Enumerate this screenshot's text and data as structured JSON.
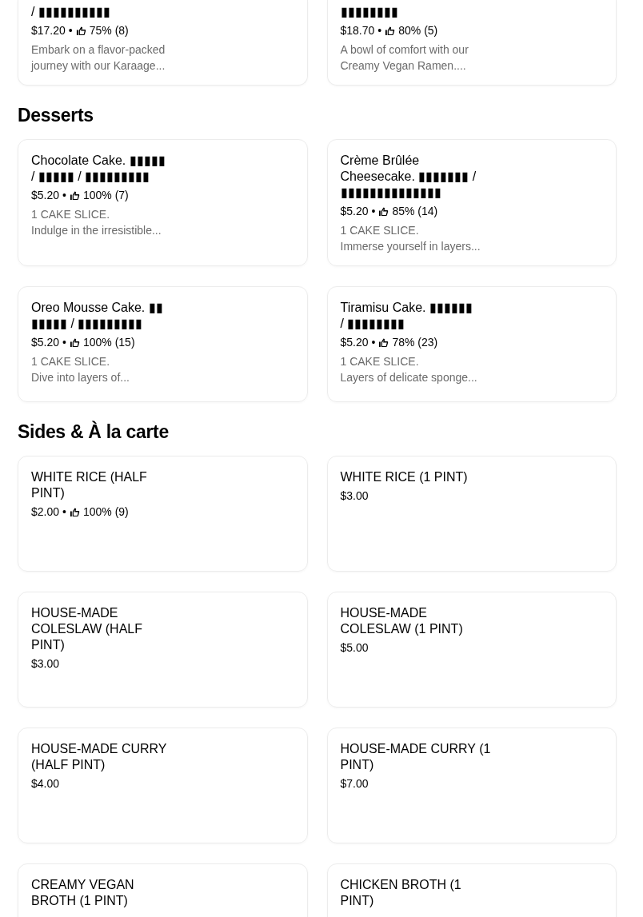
{
  "sections": [
    {
      "cut_top": true,
      "items": [
        {
          "title": "/  ▮▮▮▮▮▮▮▮▮▮",
          "price": "$17.20",
          "sep": "•",
          "rating": "75% (8)",
          "description": "Embark on a flavor-packed\njourney with our Karaage..."
        },
        {
          "title": "▮▮▮▮▮▮▮▮",
          "price": "$18.70",
          "sep": "•",
          "rating": "80% (5)",
          "description": "A bowl of comfort with our\nCreamy Vegan Ramen...."
        }
      ]
    },
    {
      "heading": "Desserts",
      "items": [
        {
          "title": "Chocolate Cake.  ▮▮▮▮▮\n/  ▮▮▮▮▮   /  ▮▮▮▮▮▮▮▮▮",
          "price": "$5.20",
          "sep": "•",
          "rating": "100% (7)",
          "description": "1 CAKE SLICE.\nIndulge in the irresistible..."
        },
        {
          "title": "Crème Brûlée\nCheesecake.  ▮▮▮▮▮▮▮   /\n▮▮▮▮▮▮▮▮▮▮▮▮▮▮",
          "price": "$5.20",
          "sep": "•",
          "rating": "85% (14)",
          "description": "1 CAKE SLICE.\nImmerse yourself in layers..."
        },
        {
          "title": "Oreo Mousse Cake.    ▮▮\n▮▮▮▮▮  /  ▮▮▮▮▮▮▮▮▮",
          "price": "$5.20",
          "sep": "•",
          "rating": "100% (15)",
          "description": "1 CAKE SLICE.\nDive into layers of..."
        },
        {
          "title": "Tiramisu Cake.    ▮▮▮▮▮▮\n/  ▮▮▮▮▮▮▮▮",
          "price": "$5.20",
          "sep": "•",
          "rating": "78% (23)",
          "description": "1 CAKE SLICE.\nLayers of delicate sponge..."
        }
      ]
    },
    {
      "heading": "Sides & À la carte",
      "items": [
        {
          "title": "WHITE RICE (HALF\nPINT)",
          "price": "$2.00",
          "sep": "•",
          "rating": "100% (9)"
        },
        {
          "title": "WHITE RICE (1 PINT)",
          "price": "$3.00"
        },
        {
          "title": "HOUSE-MADE\nCOLESLAW (HALF\nPINT)",
          "price": "$3.00"
        },
        {
          "title": "HOUSE-MADE\nCOLESLAW (1 PINT)",
          "price": "$5.00"
        },
        {
          "title": "HOUSE-MADE CURRY\n(HALF PINT)",
          "price": "$4.00"
        },
        {
          "title": "HOUSE-MADE CURRY (1\nPINT)",
          "price": "$7.00"
        },
        {
          "title": "CREAMY VEGAN\nBROTH (1 PINT)"
        },
        {
          "title": "CHICKEN BROTH (1\nPINT)"
        }
      ]
    }
  ]
}
